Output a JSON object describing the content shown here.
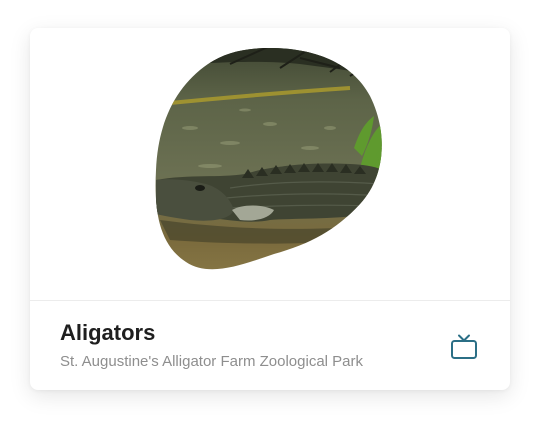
{
  "card": {
    "image_alt": "Alligator resting in shallow water",
    "title": "Aligators",
    "subtitle": "St. Augustine's Alligator Farm Zoological Park",
    "action_icon": "tv-icon",
    "accent_color": "#2b6f86"
  }
}
